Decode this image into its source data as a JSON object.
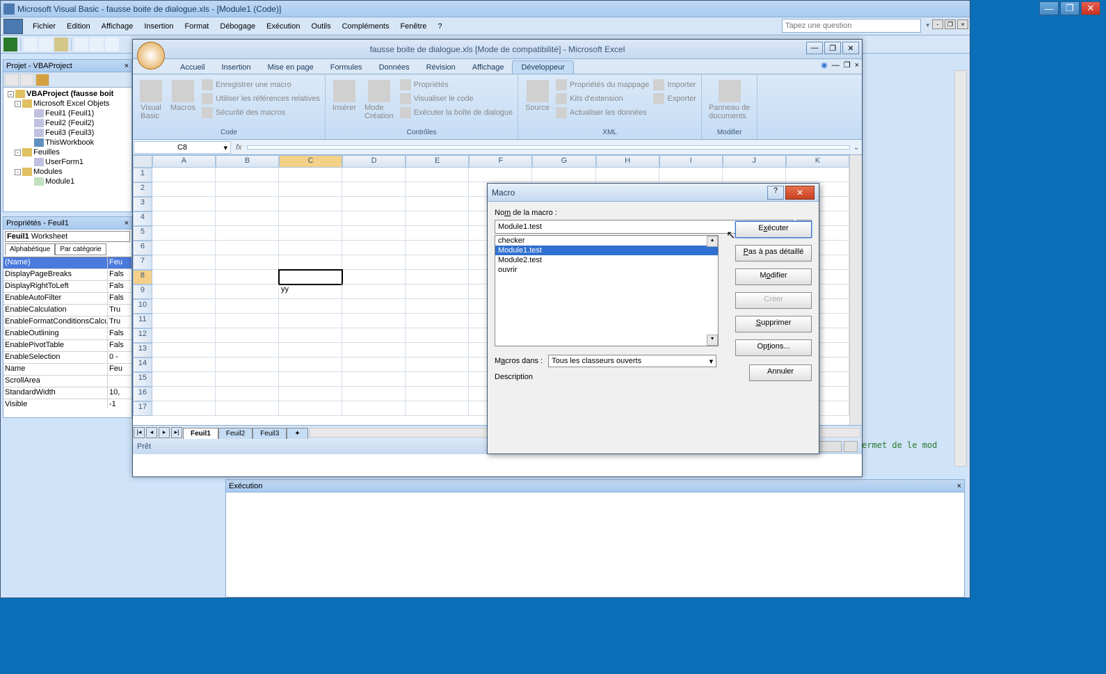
{
  "vba_titlebar": "Microsoft Visual Basic - fausse boite de dialogue.xls - [Module1 (Code)]",
  "vba_menu": [
    "Fichier",
    "Edition",
    "Affichage",
    "Insertion",
    "Format",
    "Débogage",
    "Exécution",
    "Outils",
    "Compléments",
    "Fenêtre",
    "?"
  ],
  "help_placeholder": "Tapez une question",
  "project_panel_title": "Projet - VBAProject",
  "tree": {
    "root": "VBAProject (fausse boit",
    "objets": "Microsoft Excel Objets",
    "sheets": [
      "Feuil1 (Feuil1)",
      "Feuil2 (Feuil2)",
      "Feuil3 (Feuil3)",
      "ThisWorkbook"
    ],
    "feuilles": "Feuilles",
    "userform": "UserForm1",
    "modules": "Modules",
    "module_items": [
      "Module1"
    ]
  },
  "props_panel_title": "Propriétés - Feuil1",
  "props_combo": "Feuil1 Worksheet",
  "props_tabs": [
    "Alphabétique",
    "Par catégorie"
  ],
  "props": [
    {
      "n": "(Name)",
      "v": "Feu"
    },
    {
      "n": "DisplayPageBreaks",
      "v": "Fals"
    },
    {
      "n": "DisplayRightToLeft",
      "v": "Fals"
    },
    {
      "n": "EnableAutoFilter",
      "v": "Fals"
    },
    {
      "n": "EnableCalculation",
      "v": "Tru"
    },
    {
      "n": "EnableFormatConditionsCalcu",
      "v": "Tru"
    },
    {
      "n": "EnableOutlining",
      "v": "Fals"
    },
    {
      "n": "EnablePivotTable",
      "v": "Fals"
    },
    {
      "n": "EnableSelection",
      "v": "0 -"
    },
    {
      "n": "Name",
      "v": "Feu"
    },
    {
      "n": "ScrollArea",
      "v": ""
    },
    {
      "n": "StandardWidth",
      "v": "10,"
    },
    {
      "n": "Visible",
      "v": "-1"
    }
  ],
  "excel_title": "fausse boite de dialogue.xls  [Mode de compatibilité] - Microsoft Excel",
  "ribbon_tabs": [
    "Accueil",
    "Insertion",
    "Mise en page",
    "Formules",
    "Données",
    "Révision",
    "Affichage",
    "Développeur"
  ],
  "ribbon_active_tab": "Développeur",
  "ribbon_groups": {
    "code": {
      "label": "Code",
      "big": [
        "Visual\nBasic",
        "Macros"
      ],
      "small": [
        "Enregistrer une macro",
        "Utiliser les références relatives",
        "Sécurité des macros"
      ]
    },
    "controles": {
      "label": "Contrôles",
      "big": [
        "Insérer",
        "Mode\nCréation"
      ],
      "small": [
        "Propriétés",
        "Visualiser le code",
        "Exécuter la boîte de dialogue"
      ]
    },
    "xml": {
      "label": "XML",
      "big": [
        "Source"
      ],
      "small": [
        "Propriétés du mappage",
        "Kits d'extension",
        "Actualiser les données"
      ],
      "small2": [
        "Importer",
        "Exporter"
      ]
    },
    "modifier": {
      "label": "Modifier",
      "big": [
        "Panneau de\ndocuments"
      ]
    }
  },
  "name_box": "C8",
  "columns": [
    "A",
    "B",
    "C",
    "D",
    "E",
    "F",
    "G",
    "H",
    "I",
    "J",
    "K"
  ],
  "rows": [
    1,
    2,
    3,
    4,
    5,
    6,
    7,
    8,
    9,
    10,
    11,
    12,
    13,
    14,
    15,
    16,
    17
  ],
  "active_row": 8,
  "active_col": "C",
  "cell_c9": "yy",
  "sheet_tabs": [
    "Feuil1",
    "Feuil2",
    "Feuil3"
  ],
  "active_sheet": "Feuil1",
  "status_text": "Prêt",
  "macro_dialog": {
    "title": "Macro",
    "name_label": "Nom de la macro :",
    "name_value": "Module1.test",
    "list": [
      "checker",
      "Module1.test",
      "Module2.test",
      "ouvrir"
    ],
    "selected": "Module1.test",
    "dans_label": "Macros dans :",
    "dans_value": "Tous les classeurs ouverts",
    "description_label": "Description",
    "buttons": {
      "executer": "Exécuter",
      "pas": "Pas à pas détaillé",
      "modifier": "Modifier",
      "creer": "Créer",
      "supprimer": "Supprimer",
      "options": "Options...",
      "annuler": "Annuler"
    }
  },
  "exec_panel_title": "Exécution",
  "code_hint": "ermet de le mod"
}
